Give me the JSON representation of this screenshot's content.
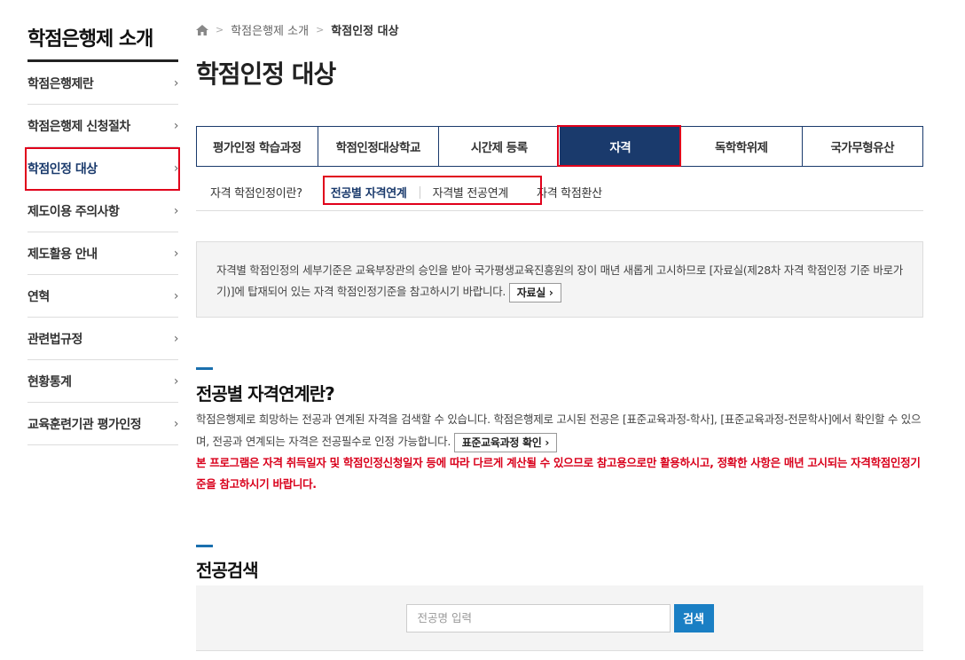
{
  "sidebar": {
    "title": "학점은행제 소개",
    "items": [
      {
        "label": "학점은행제란"
      },
      {
        "label": "학점은행제 신청절차"
      },
      {
        "label": "학점인정 대상"
      },
      {
        "label": "제도이용 주의사항"
      },
      {
        "label": "제도활용 안내"
      },
      {
        "label": "연혁"
      },
      {
        "label": "관련법규정"
      },
      {
        "label": "현황통계"
      },
      {
        "label": "교육훈련기관 평가인정"
      }
    ],
    "chevron": "›"
  },
  "breadcrumb": {
    "parent": "학점은행제 소개",
    "current": "학점인정 대상",
    "separator": ">"
  },
  "page": {
    "title": "학점인정 대상"
  },
  "tabs": [
    {
      "label": "평가인정 학습과정"
    },
    {
      "label": "학점인정대상학교"
    },
    {
      "label": "시간제 등록"
    },
    {
      "label": "자격"
    },
    {
      "label": "독학학위제"
    },
    {
      "label": "국가무형유산"
    }
  ],
  "subtabs": [
    {
      "label": "자격 학점인정이란?"
    },
    {
      "label": "전공별 자격연계"
    },
    {
      "label": "자격별 전공연계"
    },
    {
      "label": "자격 학점환산"
    }
  ],
  "notice": {
    "text": "자격별 학점인정의 세부기준은 교육부장관의 승인을 받아 국가평생교육진흥원의 장이 매년 새롭게 고시하므로 [자료실(제28차 자격 학점인정 기준 바로가기)]에 탑재되어 있는 자격 학점인정기준을 참고하시기 바랍니다.",
    "button": "자료실 ›"
  },
  "section1": {
    "title": "전공별 자격연계란?",
    "desc": "학점은행제로 희망하는 전공과 연계된 자격을 검색할 수 있습니다. 학점은행제로 고시된 전공은 [표준교육과정-학사], [표준교육과정-전문학사]에서 확인할 수 있으며, 전공과 연계되는 자격은 전공필수로 인정 가능합니다.",
    "button": "표준교육과정 확인 ›",
    "warning": "본 프로그램은 자격 취득일자 및 학점인정신청일자 등에 따라 다르게 계산될 수 있으므로 참고용으로만 활용하시고, 정확한 사항은 매년 고시되는 자격학점인정기준을 참고하시기 바랍니다."
  },
  "section2": {
    "title": "전공검색",
    "placeholder": "전공명 입력",
    "button": "검색"
  },
  "colors": {
    "navy": "#1a3a6c",
    "highlight": "#e0001b",
    "warning": "#d9001b",
    "search_button": "#1a7fc4"
  }
}
